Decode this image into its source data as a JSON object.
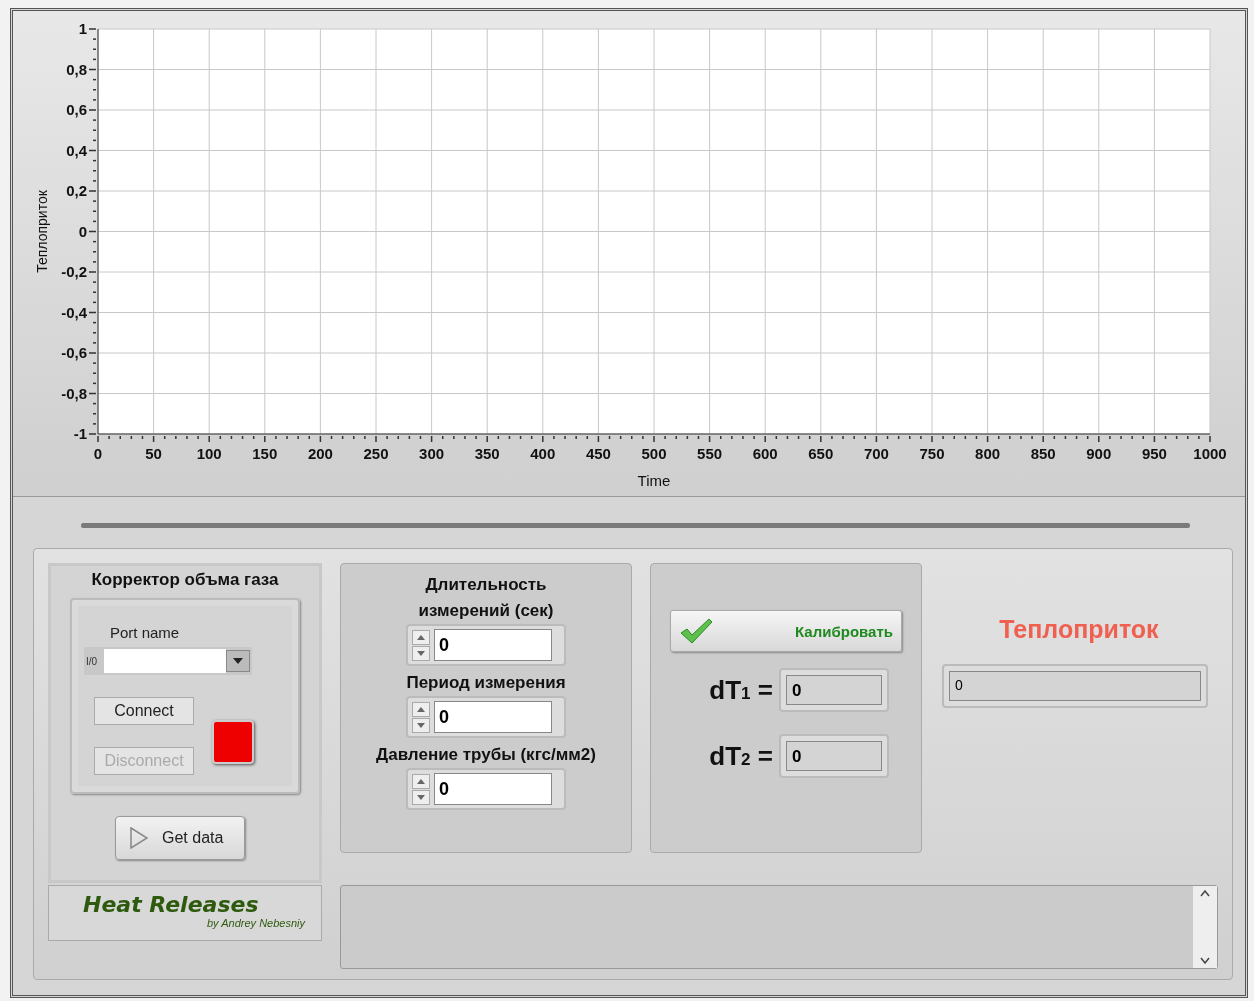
{
  "chart": {
    "chart_data": {
      "type": "line",
      "grid": true,
      "xlabel": "Time",
      "ylabel": "Теплоприток",
      "xlim": [
        0,
        1000
      ],
      "ylim": [
        -1,
        1
      ],
      "xticks": [
        0,
        50,
        100,
        150,
        200,
        250,
        300,
        350,
        400,
        450,
        500,
        550,
        600,
        650,
        700,
        750,
        800,
        850,
        900,
        950,
        1000
      ],
      "yticks": [
        {
          "value": 1,
          "label": "1"
        },
        {
          "value": 0.8,
          "label": "0,8"
        },
        {
          "value": 0.6,
          "label": "0,6"
        },
        {
          "value": 0.4,
          "label": "0,4"
        },
        {
          "value": 0.2,
          "label": "0,2"
        },
        {
          "value": 0,
          "label": "0"
        },
        {
          "value": -0.2,
          "label": "-0,2"
        },
        {
          "value": -0.4,
          "label": "-0,4"
        },
        {
          "value": -0.6,
          "label": "-0,6"
        },
        {
          "value": -0.8,
          "label": "-0,8"
        },
        {
          "value": -1,
          "label": "-1"
        }
      ]
    }
  },
  "gas_corrector": {
    "title": "Корректор объма газа",
    "port_label": "Port name",
    "port_prefix": "I/0",
    "buttons": [
      {
        "label": "Connect",
        "disabled": false
      },
      {
        "label": "Disconnect",
        "disabled": true
      }
    ],
    "status_light": {
      "on": true
    },
    "get_data": "Get data"
  },
  "logo": {
    "title": "Heat Releases",
    "byline": "by Andrey Nebesniy"
  },
  "settings": [
    {
      "label": "Длительность измерений (сек)",
      "value": "0"
    },
    {
      "label": "Период измерения",
      "value": "0"
    },
    {
      "label": "Давление трубы (кгс/мм2)",
      "value": "0"
    }
  ],
  "calibration": {
    "button": "Калибровать",
    "readings": [
      {
        "label": "dT$_{1}$ =",
        "value": "0"
      },
      {
        "label": "dT$_{2}$ =",
        "value": "0"
      }
    ]
  },
  "heat_inflow": {
    "title": "Теплоприток",
    "value": "0"
  }
}
